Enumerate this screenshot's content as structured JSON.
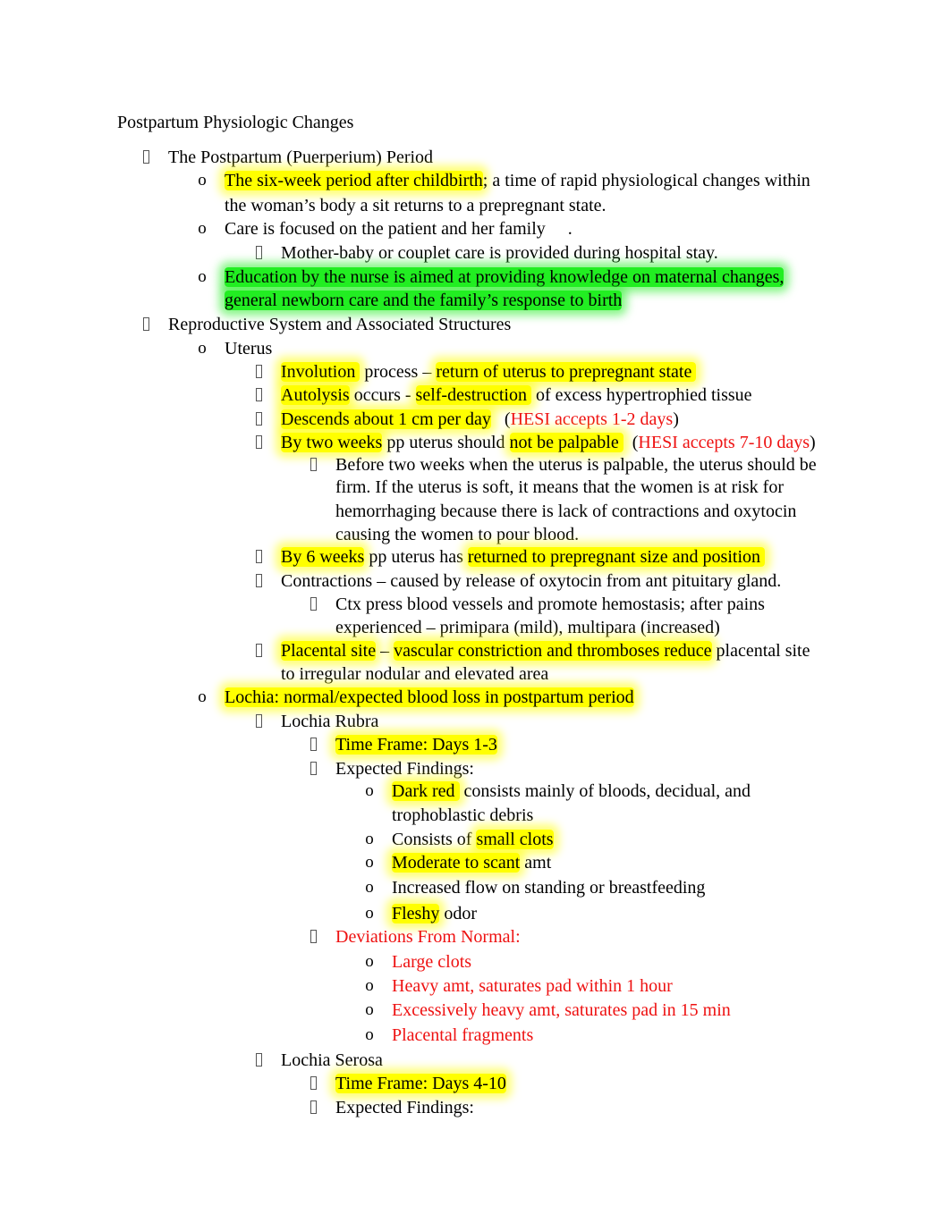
{
  "document": {
    "title": "Postpartum Physiologic Changes",
    "lines": [
      {
        "level": 1,
        "bullet": "square",
        "segments": [
          {
            "t": "The Postpartum (Puerperium) Period"
          }
        ]
      },
      {
        "level": 2,
        "bullet": "o",
        "segments": [
          {
            "t": "The six-week period after childbirth",
            "hl": "yellow"
          },
          {
            "t": "; a time of rapid physiological changes within"
          }
        ]
      },
      {
        "level": 2,
        "bullet": "",
        "segments": [
          {
            "t": "the woman’s body a sit returns to a prepregnant state."
          }
        ]
      },
      {
        "level": 2,
        "bullet": "o",
        "segments": [
          {
            "t": "Care is focused on the patient and her family     ."
          }
        ]
      },
      {
        "level": 3,
        "bullet": "square",
        "segments": [
          {
            "t": "Mother-baby or couplet care is provided during hospital stay."
          }
        ]
      },
      {
        "level": 2,
        "bullet": "o",
        "hlline": "green",
        "segments": [
          {
            "t": "Education by the nurse is aimed at providing knowledge on maternal changes,",
            "hl": "green"
          }
        ]
      },
      {
        "level": 2,
        "bullet": "",
        "segments": [
          {
            "t": "general newborn care and the family’s response to birth",
            "hl": "green"
          }
        ]
      },
      {
        "level": 1,
        "bullet": "square",
        "segments": [
          {
            "t": "Reproductive System and Associated Structures"
          }
        ]
      },
      {
        "level": 2,
        "bullet": "o",
        "segments": [
          {
            "t": "Uterus"
          }
        ]
      },
      {
        "level": 3,
        "bullet": "square",
        "segments": [
          {
            "t": "Involution ",
            "hl": "yellow"
          },
          {
            "t": " process – "
          },
          {
            "t": "return of uterus to prepregnant state ",
            "hl": "yellow"
          }
        ]
      },
      {
        "level": 3,
        "bullet": "square",
        "segments": [
          {
            "t": "Autolysis",
            "hl": "yellow"
          },
          {
            "t": " occurs - "
          },
          {
            "t": "self-destruction ",
            "hl": "yellow"
          },
          {
            "t": " of excess hypertrophied tissue"
          }
        ]
      },
      {
        "level": 3,
        "bullet": "square",
        "segments": [
          {
            "t": "Descends about 1 cm per day",
            "hl": "yellow"
          },
          {
            "t": "   ("
          },
          {
            "t": "HESI accepts 1-2 days",
            "red": true
          },
          {
            "t": ")"
          }
        ]
      },
      {
        "level": 3,
        "bullet": "square",
        "segments": [
          {
            "t": "By two weeks",
            "hl": "yellow"
          },
          {
            "t": " pp uterus should "
          },
          {
            "t": "not be palpable ",
            "hl": "yellow"
          },
          {
            "t": "  ("
          },
          {
            "t": "HESI accepts 7-10 days",
            "red": true
          },
          {
            "t": ")"
          }
        ]
      },
      {
        "level": 4,
        "bullet": "square",
        "segments": [
          {
            "t": "Before two weeks when the uterus is palpable, the uterus should be"
          }
        ]
      },
      {
        "level": 4,
        "bullet": "",
        "segments": [
          {
            "t": "firm. If the uterus is soft, it means that the women is at risk for"
          }
        ]
      },
      {
        "level": 4,
        "bullet": "",
        "segments": [
          {
            "t": "hemorrhaging because there is lack of contractions and oxytocin"
          }
        ]
      },
      {
        "level": 4,
        "bullet": "",
        "segments": [
          {
            "t": "causing the women to pour blood."
          }
        ]
      },
      {
        "level": 3,
        "bullet": "square",
        "segments": [
          {
            "t": "By 6 weeks",
            "hl": "yellow"
          },
          {
            "t": " pp uterus has "
          },
          {
            "t": "returned to prepregnant size and position ",
            "hl": "yellow"
          }
        ]
      },
      {
        "level": 3,
        "bullet": "square",
        "segments": [
          {
            "t": "Contractions – caused by release of oxytocin from ant pituitary gland."
          }
        ]
      },
      {
        "level": 4,
        "bullet": "square",
        "segments": [
          {
            "t": "Ctx press blood vessels and promote hemostasis; after pains"
          }
        ]
      },
      {
        "level": 4,
        "bullet": "",
        "segments": [
          {
            "t": "experienced – primipara (mild), multipara (increased)"
          }
        ]
      },
      {
        "level": 3,
        "bullet": "square",
        "segments": [
          {
            "t": "Placental site",
            "hl": "yellow"
          },
          {
            "t": " – "
          },
          {
            "t": "vascular constriction and thromboses reduce",
            "hl": "yellow"
          },
          {
            "t": " placental site"
          }
        ]
      },
      {
        "level": 3,
        "bullet": "",
        "segments": [
          {
            "t": "to irregular nodular and elevated area"
          }
        ]
      },
      {
        "level": 2,
        "bullet": "o",
        "segments": [
          {
            "t": "Lochia: normal/expected blood loss in postpartum period",
            "hl": "yellow"
          }
        ]
      },
      {
        "level": 3,
        "bullet": "square",
        "segments": [
          {
            "t": "Lochia Rubra"
          }
        ]
      },
      {
        "level": 4,
        "bullet": "square",
        "segments": [
          {
            "t": "Time Frame: Days 1-3",
            "hl": "yellow"
          }
        ]
      },
      {
        "level": 4,
        "bullet": "square",
        "segments": [
          {
            "t": "Expected Findings:"
          }
        ]
      },
      {
        "level": 5,
        "bullet": "o",
        "segments": [
          {
            "t": "Dark red ",
            "hl": "yellow"
          },
          {
            "t": " consists mainly of bloods, decidual, and"
          }
        ]
      },
      {
        "level": 5,
        "bullet": "",
        "segments": [
          {
            "t": "trophoblastic debris"
          }
        ]
      },
      {
        "level": 5,
        "bullet": "o",
        "segments": [
          {
            "t": "Consists of "
          },
          {
            "t": "small clots",
            "hl": "yellow"
          }
        ]
      },
      {
        "level": 5,
        "bullet": "o",
        "segments": [
          {
            "t": "Moderate to scant",
            "hl": "yellow"
          },
          {
            "t": " amt"
          }
        ]
      },
      {
        "level": 5,
        "bullet": "o",
        "segments": [
          {
            "t": "Increased flow on standing or breastfeeding"
          }
        ]
      },
      {
        "level": 5,
        "bullet": "o",
        "segments": [
          {
            "t": "Fleshy",
            "hl": "yellow"
          },
          {
            "t": " odor"
          }
        ]
      },
      {
        "level": 4,
        "bullet": "square",
        "segments": [
          {
            "t": "Deviations From Normal:",
            "red": true
          }
        ]
      },
      {
        "level": 5,
        "bullet": "o",
        "segments": [
          {
            "t": "Large clots",
            "red": true
          }
        ]
      },
      {
        "level": 5,
        "bullet": "o",
        "segments": [
          {
            "t": "Heavy amt, saturates pad within 1 hour",
            "red": true
          }
        ]
      },
      {
        "level": 5,
        "bullet": "o",
        "segments": [
          {
            "t": "Excessively heavy amt, saturates pad in 15 min",
            "red": true
          }
        ]
      },
      {
        "level": 5,
        "bullet": "o",
        "segments": [
          {
            "t": "Placental fragments",
            "red": true
          }
        ]
      },
      {
        "level": 3,
        "bullet": "square",
        "segments": [
          {
            "t": "Lochia Serosa"
          }
        ]
      },
      {
        "level": 4,
        "bullet": "square",
        "segments": [
          {
            "t": "Time Frame: Days 4-10",
            "hl": "yellow"
          }
        ]
      },
      {
        "level": 4,
        "bullet": "square",
        "segments": [
          {
            "t": "Expected Findings:"
          }
        ]
      }
    ]
  },
  "colors": {
    "highlight_yellow": "#ffff00",
    "highlight_green": "#22ee22",
    "red_text": "#ee1111"
  }
}
